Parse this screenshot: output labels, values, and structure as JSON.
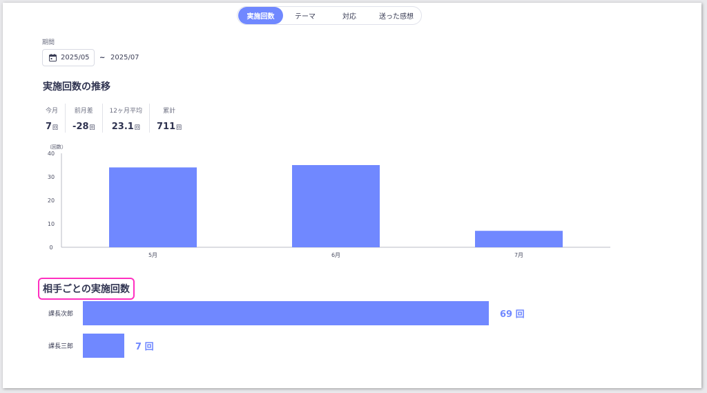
{
  "tabs": [
    {
      "label": "実施回数",
      "active": true
    },
    {
      "label": "テーマ",
      "active": false
    },
    {
      "label": "対応",
      "active": false
    },
    {
      "label": "送った感想",
      "active": false
    }
  ],
  "period": {
    "label": "期間",
    "start": "2025/05",
    "separator": "~",
    "end": "2025/07"
  },
  "trend": {
    "title": "実施回数の推移",
    "stats": [
      {
        "label": "今月",
        "value": "7",
        "unit": "回"
      },
      {
        "label": "前月差",
        "value": "-28",
        "unit": "回"
      },
      {
        "label": "12ヶ月平均",
        "value": "23.1",
        "unit": "回"
      },
      {
        "label": "累計",
        "value": "711",
        "unit": "回"
      }
    ]
  },
  "partner": {
    "title": "相手ごとの実施回数",
    "unit": "回"
  },
  "colors": {
    "accent": "#7088ff",
    "highlight_border": "#ff2fc0"
  },
  "chart_data": [
    {
      "type": "bar",
      "ylabel": "（回数）",
      "categories": [
        "5月",
        "6月",
        "7月"
      ],
      "values": [
        34,
        35,
        7
      ],
      "ylim": [
        0,
        40
      ],
      "yticks": [
        0,
        10,
        20,
        30,
        40
      ],
      "grid": false
    },
    {
      "type": "bar",
      "orientation": "horizontal",
      "categories": [
        "課長次郎",
        "課長三郎"
      ],
      "values": [
        69,
        7
      ]
    }
  ]
}
